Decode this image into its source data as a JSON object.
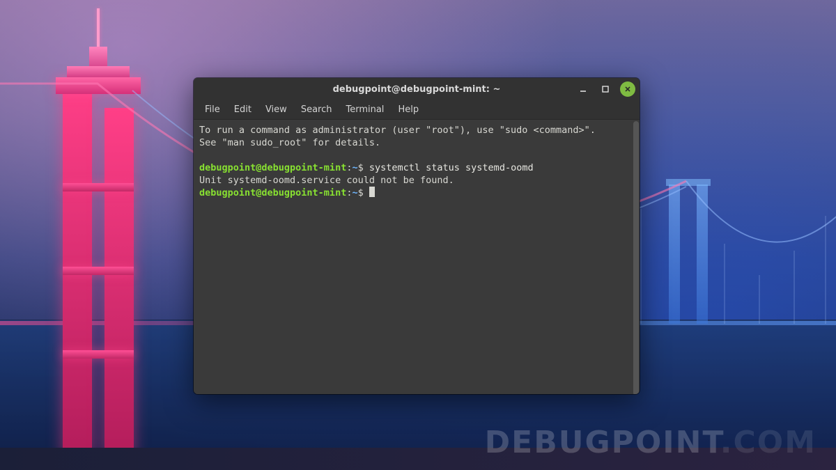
{
  "watermark": {
    "dark": "DEBUGPOINT",
    "light": ".COM"
  },
  "window": {
    "title": "debugpoint@debugpoint-mint: ~",
    "menu": {
      "file": "File",
      "edit": "Edit",
      "view": "View",
      "search": "Search",
      "terminal": "Terminal",
      "help": "Help"
    }
  },
  "terminal": {
    "motd_line1": "To run a command as administrator (user \"root\"), use \"sudo <command>\".",
    "motd_line2": "See \"man sudo_root\" for details.",
    "prompt": {
      "userhost": "debugpoint@debugpoint-mint",
      "colon": ":",
      "path": "~",
      "dollar": "$"
    },
    "command1": " systemctl status systemd-oomd",
    "output1": "Unit systemd-oomd.service could not be found.",
    "command2": " "
  },
  "colors": {
    "close_button": "#7fbb42",
    "prompt_green": "#88e131",
    "prompt_blue": "#6fb7ff",
    "terminal_bg": "#3a3a3a"
  }
}
